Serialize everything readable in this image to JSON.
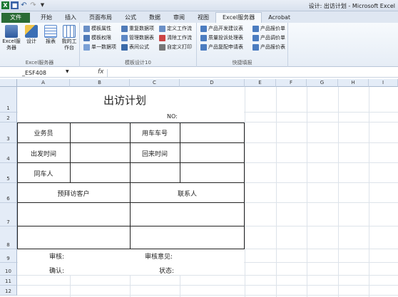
{
  "window": {
    "title": "设计: 出访计划 - Microsoft Excel",
    "qat": {
      "logo": "X",
      "undo_icon": "undo-icon",
      "redo_icon": "redo-icon"
    }
  },
  "tabs": [
    "文件",
    "开始",
    "插入",
    "页面布局",
    "公式",
    "数据",
    "审阅",
    "视图",
    "Excel服务器",
    "Acrobat"
  ],
  "active_tab": "Excel服务器",
  "ribbon": {
    "group1": {
      "label": "Excel服务器",
      "buttons": [
        "Excel服务器",
        "设计",
        "报表",
        "我的工作台"
      ]
    },
    "group2": {
      "label": "模板设计10",
      "items": [
        "模板属性",
        "模板权限",
        "单一数据项",
        "重复数据项",
        "管理数据表",
        "表间公式",
        "定义工作流",
        "清除工作流",
        "自定义打印"
      ]
    },
    "group3": {
      "label": "快捷填报",
      "items": [
        "产品开发建议表",
        "质量投诉处理表",
        "产品复配申请表",
        "产品报价单",
        "产品调价单",
        "产品报价表"
      ]
    }
  },
  "formula_bar": {
    "name_box": "_ESF408",
    "fx": "fx",
    "value": ""
  },
  "columns": [
    "A",
    "B",
    "C",
    "D",
    "E",
    "F",
    "G",
    "H",
    "I"
  ],
  "rows": [
    "1",
    "2",
    "3",
    "4",
    "5",
    "6",
    "7",
    "8",
    "9",
    "10",
    "11",
    "12"
  ],
  "sheet": {
    "title": "出访计划",
    "no_label": "NO:",
    "salesperson": "业务员",
    "car_number": "用车车号",
    "depart_time": "出发时间",
    "return_time": "回来时间",
    "companion": "同车人",
    "planned_clients": "预拜访客户",
    "contact": "联系人",
    "review": "审核:",
    "review_opinion": "审核意见:",
    "confirm": "确认:",
    "status": "状态:"
  },
  "colors": {
    "file_tab": "#2a6b35",
    "header_bg": "#e4ecf7",
    "ribbon_bg": "#eaf0f7"
  }
}
